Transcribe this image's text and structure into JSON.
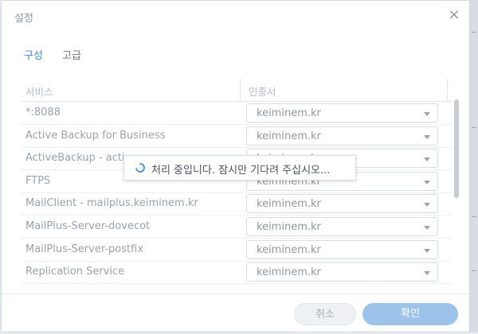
{
  "dialog": {
    "title": "설정",
    "close_glyph": "×"
  },
  "tabs": [
    {
      "label": "구성",
      "active": true
    },
    {
      "label": "고급",
      "active": false
    }
  ],
  "table": {
    "headers": [
      "서비스",
      "인증서"
    ],
    "rows": [
      {
        "service": "*:8088",
        "certificate": "keiminem.kr"
      },
      {
        "service": "Active Backup for Business",
        "certificate": "keiminem.kr"
      },
      {
        "service": "ActiveBackup - acti",
        "certificate": "keiminem.kr"
      },
      {
        "service": "FTPS",
        "certificate": "keiminem.kr"
      },
      {
        "service": "MailClient - mailplus.keiminem.kr",
        "certificate": "keiminem.kr"
      },
      {
        "service": "MailPlus-Server-dovecot",
        "certificate": "keiminem.kr"
      },
      {
        "service": "MailPlus-Server-postfix",
        "certificate": "keiminem.kr"
      },
      {
        "service": "Replication Service",
        "certificate": "keiminem.kr"
      }
    ]
  },
  "loading": {
    "message": "처리 중입니다. 잠시만 기다려 주십시오..."
  },
  "footer": {
    "cancel_label": "취소",
    "ok_label": "확인"
  },
  "colors": {
    "accent": "#3f8bd8",
    "primary_button": "#9ec3ea"
  },
  "icons": {
    "close": "close-icon",
    "dropdown": "chevron-down-icon",
    "spinner": "spinner-icon"
  }
}
